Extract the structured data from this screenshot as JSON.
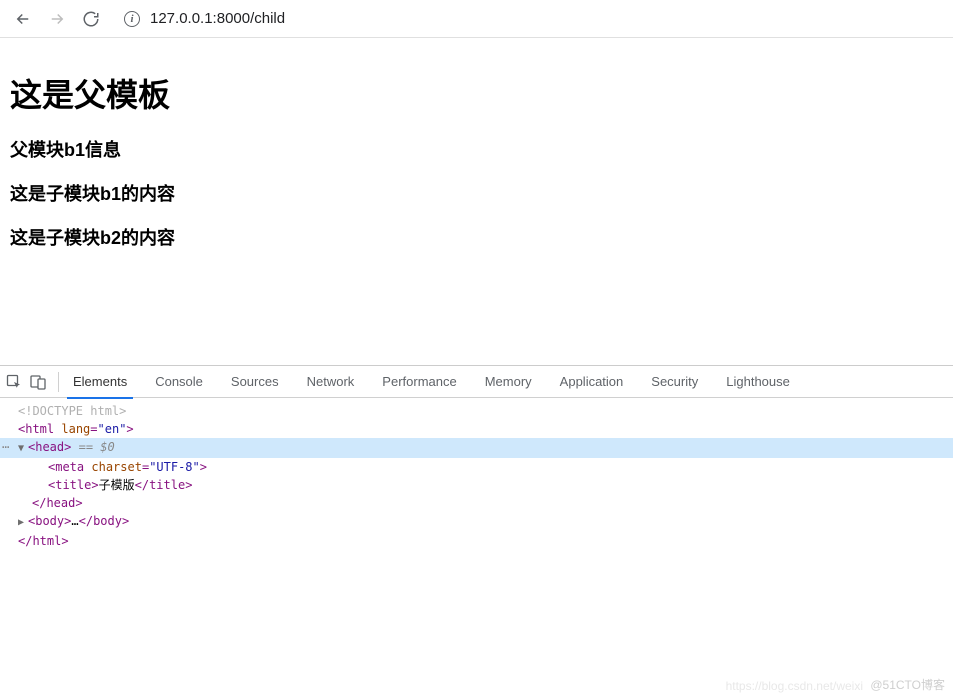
{
  "browser": {
    "url": "127.0.0.1:8000/child",
    "info_glyph": "i"
  },
  "page": {
    "h1": "这是父模板",
    "h2_1": "父模块b1信息",
    "h2_2": "这是子模块b1的内容",
    "h2_3": "这是子模块b2的内容"
  },
  "devtools": {
    "tabs": {
      "elements": "Elements",
      "console": "Console",
      "sources": "Sources",
      "network": "Network",
      "performance": "Performance",
      "memory": "Memory",
      "application": "Application",
      "security": "Security",
      "lighthouse": "Lighthouse"
    },
    "code": {
      "doctype": "<!DOCTYPE html>",
      "html_open_tag": "html",
      "html_lang_attr": "lang",
      "html_lang_val": "\"en\"",
      "head_tag": "head",
      "eq_dollar": " == $0",
      "meta_tag": "meta",
      "meta_attr": "charset",
      "meta_val": "\"UTF-8\"",
      "title_tag": "title",
      "title_text": "子模版",
      "head_close": "head",
      "body_tag": "body",
      "body_ellipsis": "…",
      "html_close": "html"
    }
  },
  "watermark": {
    "right": "@51CTO博客",
    "faint": "https://blog.csdn.net/weixi"
  }
}
